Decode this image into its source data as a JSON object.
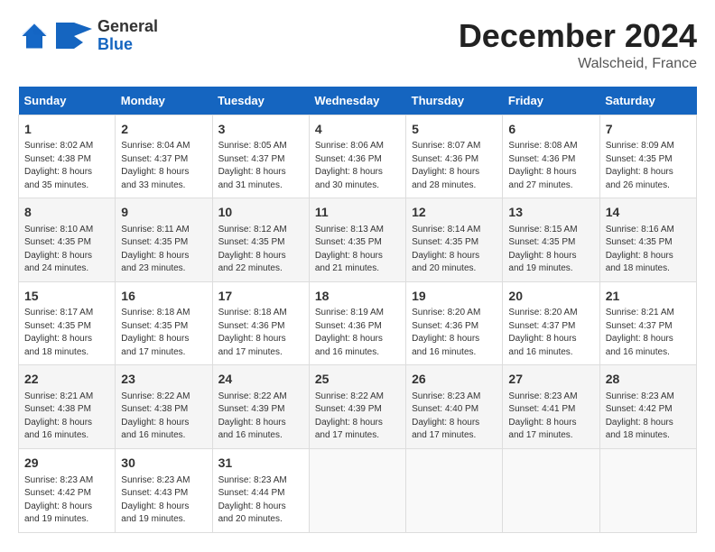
{
  "header": {
    "logo_general": "General",
    "logo_blue": "Blue",
    "month_title": "December 2024",
    "location": "Walscheid, France"
  },
  "days_of_week": [
    "Sunday",
    "Monday",
    "Tuesday",
    "Wednesday",
    "Thursday",
    "Friday",
    "Saturday"
  ],
  "weeks": [
    [
      {
        "day": "1",
        "sunrise": "Sunrise: 8:02 AM",
        "sunset": "Sunset: 4:38 PM",
        "daylight": "Daylight: 8 hours and 35 minutes."
      },
      {
        "day": "2",
        "sunrise": "Sunrise: 8:04 AM",
        "sunset": "Sunset: 4:37 PM",
        "daylight": "Daylight: 8 hours and 33 minutes."
      },
      {
        "day": "3",
        "sunrise": "Sunrise: 8:05 AM",
        "sunset": "Sunset: 4:37 PM",
        "daylight": "Daylight: 8 hours and 31 minutes."
      },
      {
        "day": "4",
        "sunrise": "Sunrise: 8:06 AM",
        "sunset": "Sunset: 4:36 PM",
        "daylight": "Daylight: 8 hours and 30 minutes."
      },
      {
        "day": "5",
        "sunrise": "Sunrise: 8:07 AM",
        "sunset": "Sunset: 4:36 PM",
        "daylight": "Daylight: 8 hours and 28 minutes."
      },
      {
        "day": "6",
        "sunrise": "Sunrise: 8:08 AM",
        "sunset": "Sunset: 4:36 PM",
        "daylight": "Daylight: 8 hours and 27 minutes."
      },
      {
        "day": "7",
        "sunrise": "Sunrise: 8:09 AM",
        "sunset": "Sunset: 4:35 PM",
        "daylight": "Daylight: 8 hours and 26 minutes."
      }
    ],
    [
      {
        "day": "8",
        "sunrise": "Sunrise: 8:10 AM",
        "sunset": "Sunset: 4:35 PM",
        "daylight": "Daylight: 8 hours and 24 minutes."
      },
      {
        "day": "9",
        "sunrise": "Sunrise: 8:11 AM",
        "sunset": "Sunset: 4:35 PM",
        "daylight": "Daylight: 8 hours and 23 minutes."
      },
      {
        "day": "10",
        "sunrise": "Sunrise: 8:12 AM",
        "sunset": "Sunset: 4:35 PM",
        "daylight": "Daylight: 8 hours and 22 minutes."
      },
      {
        "day": "11",
        "sunrise": "Sunrise: 8:13 AM",
        "sunset": "Sunset: 4:35 PM",
        "daylight": "Daylight: 8 hours and 21 minutes."
      },
      {
        "day": "12",
        "sunrise": "Sunrise: 8:14 AM",
        "sunset": "Sunset: 4:35 PM",
        "daylight": "Daylight: 8 hours and 20 minutes."
      },
      {
        "day": "13",
        "sunrise": "Sunrise: 8:15 AM",
        "sunset": "Sunset: 4:35 PM",
        "daylight": "Daylight: 8 hours and 19 minutes."
      },
      {
        "day": "14",
        "sunrise": "Sunrise: 8:16 AM",
        "sunset": "Sunset: 4:35 PM",
        "daylight": "Daylight: 8 hours and 18 minutes."
      }
    ],
    [
      {
        "day": "15",
        "sunrise": "Sunrise: 8:17 AM",
        "sunset": "Sunset: 4:35 PM",
        "daylight": "Daylight: 8 hours and 18 minutes."
      },
      {
        "day": "16",
        "sunrise": "Sunrise: 8:18 AM",
        "sunset": "Sunset: 4:35 PM",
        "daylight": "Daylight: 8 hours and 17 minutes."
      },
      {
        "day": "17",
        "sunrise": "Sunrise: 8:18 AM",
        "sunset": "Sunset: 4:36 PM",
        "daylight": "Daylight: 8 hours and 17 minutes."
      },
      {
        "day": "18",
        "sunrise": "Sunrise: 8:19 AM",
        "sunset": "Sunset: 4:36 PM",
        "daylight": "Daylight: 8 hours and 16 minutes."
      },
      {
        "day": "19",
        "sunrise": "Sunrise: 8:20 AM",
        "sunset": "Sunset: 4:36 PM",
        "daylight": "Daylight: 8 hours and 16 minutes."
      },
      {
        "day": "20",
        "sunrise": "Sunrise: 8:20 AM",
        "sunset": "Sunset: 4:37 PM",
        "daylight": "Daylight: 8 hours and 16 minutes."
      },
      {
        "day": "21",
        "sunrise": "Sunrise: 8:21 AM",
        "sunset": "Sunset: 4:37 PM",
        "daylight": "Daylight: 8 hours and 16 minutes."
      }
    ],
    [
      {
        "day": "22",
        "sunrise": "Sunrise: 8:21 AM",
        "sunset": "Sunset: 4:38 PM",
        "daylight": "Daylight: 8 hours and 16 minutes."
      },
      {
        "day": "23",
        "sunrise": "Sunrise: 8:22 AM",
        "sunset": "Sunset: 4:38 PM",
        "daylight": "Daylight: 8 hours and 16 minutes."
      },
      {
        "day": "24",
        "sunrise": "Sunrise: 8:22 AM",
        "sunset": "Sunset: 4:39 PM",
        "daylight": "Daylight: 8 hours and 16 minutes."
      },
      {
        "day": "25",
        "sunrise": "Sunrise: 8:22 AM",
        "sunset": "Sunset: 4:39 PM",
        "daylight": "Daylight: 8 hours and 17 minutes."
      },
      {
        "day": "26",
        "sunrise": "Sunrise: 8:23 AM",
        "sunset": "Sunset: 4:40 PM",
        "daylight": "Daylight: 8 hours and 17 minutes."
      },
      {
        "day": "27",
        "sunrise": "Sunrise: 8:23 AM",
        "sunset": "Sunset: 4:41 PM",
        "daylight": "Daylight: 8 hours and 17 minutes."
      },
      {
        "day": "28",
        "sunrise": "Sunrise: 8:23 AM",
        "sunset": "Sunset: 4:42 PM",
        "daylight": "Daylight: 8 hours and 18 minutes."
      }
    ],
    [
      {
        "day": "29",
        "sunrise": "Sunrise: 8:23 AM",
        "sunset": "Sunset: 4:42 PM",
        "daylight": "Daylight: 8 hours and 19 minutes."
      },
      {
        "day": "30",
        "sunrise": "Sunrise: 8:23 AM",
        "sunset": "Sunset: 4:43 PM",
        "daylight": "Daylight: 8 hours and 19 minutes."
      },
      {
        "day": "31",
        "sunrise": "Sunrise: 8:23 AM",
        "sunset": "Sunset: 4:44 PM",
        "daylight": "Daylight: 8 hours and 20 minutes."
      },
      null,
      null,
      null,
      null
    ]
  ]
}
